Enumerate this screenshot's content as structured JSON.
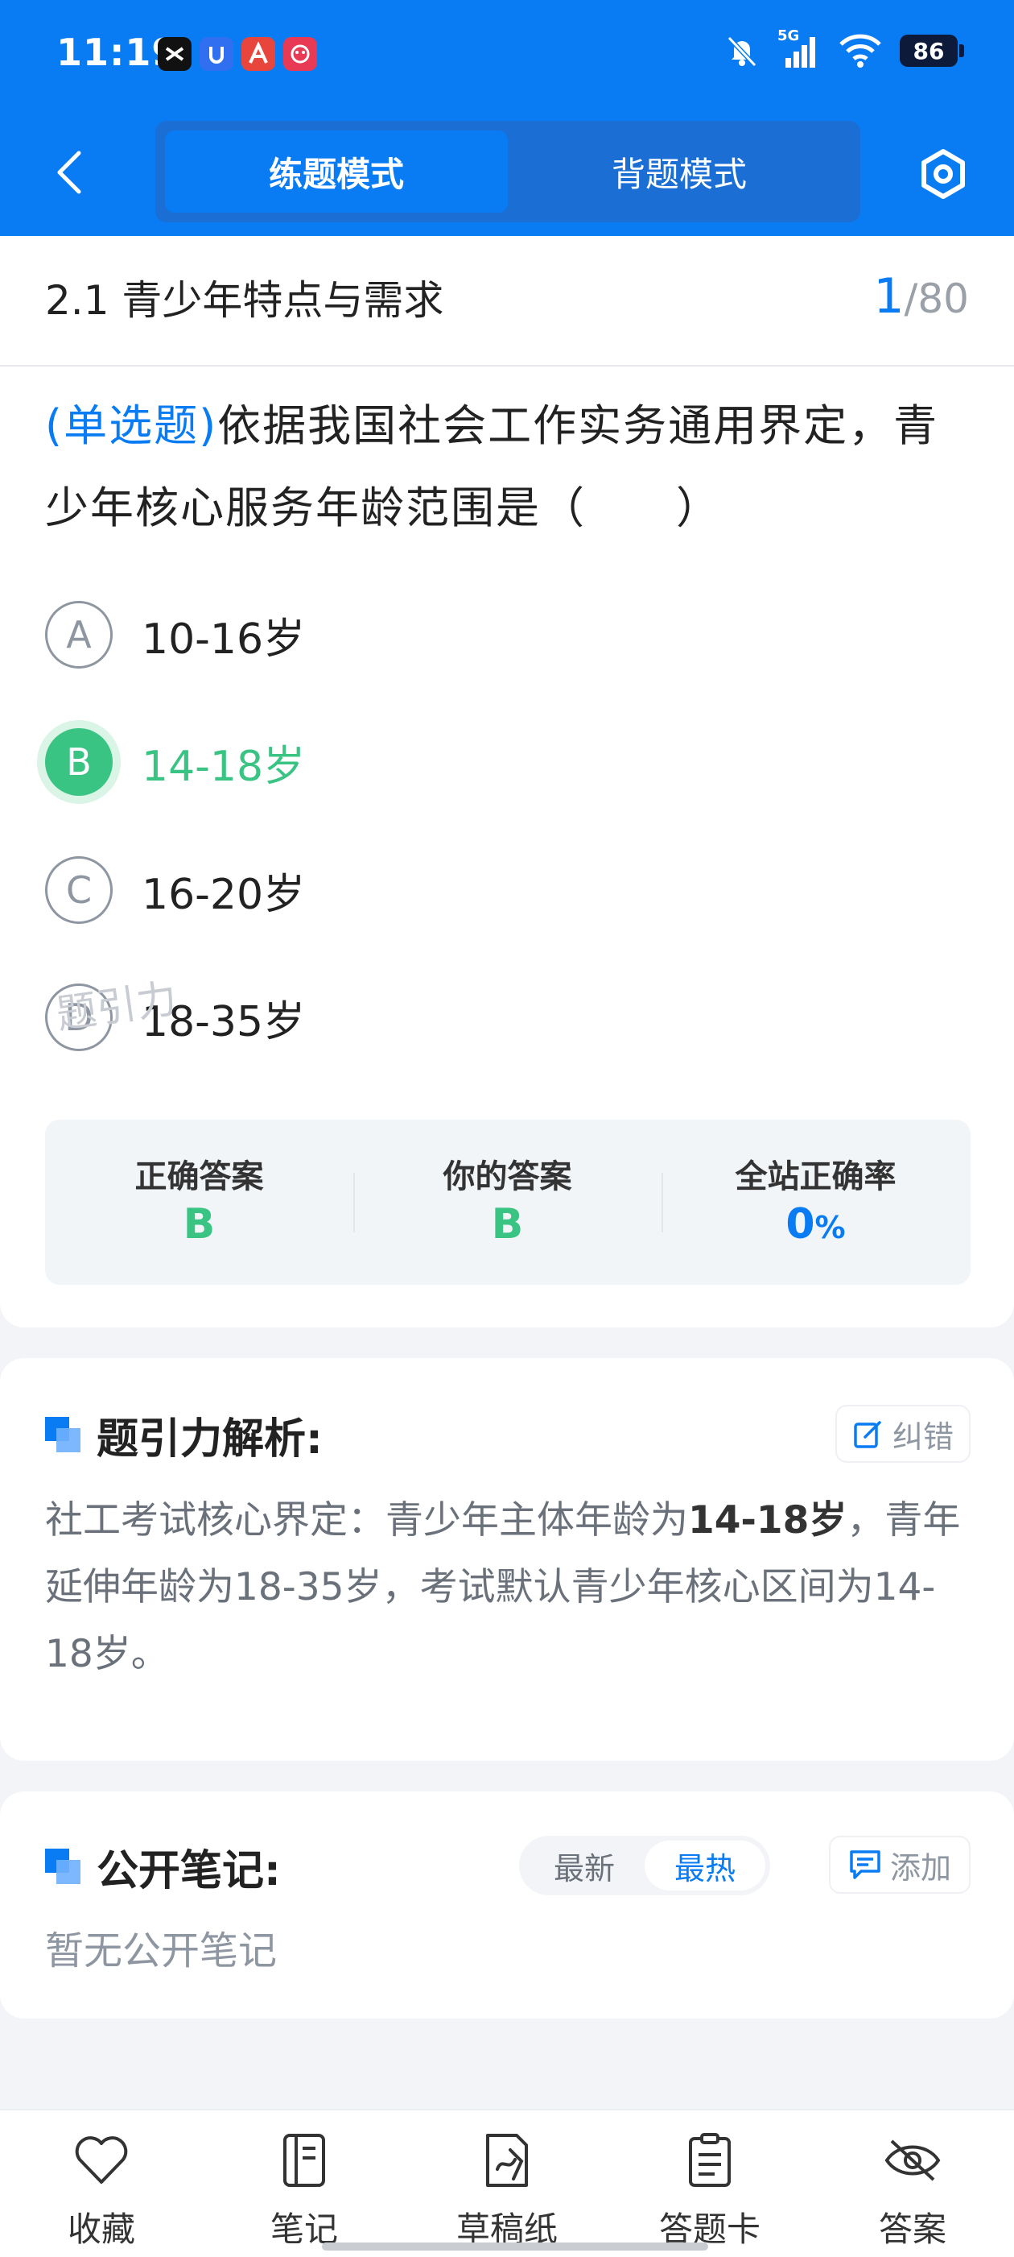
{
  "status_bar": {
    "time": "11:19",
    "battery": "86",
    "network": "5G"
  },
  "nav": {
    "tab_practice": "练题模式",
    "tab_memorize": "背题模式"
  },
  "section": {
    "title": "2.1 青少年特点与需求",
    "current": "1",
    "separator": "/",
    "total": "80"
  },
  "question": {
    "type": "(单选题)",
    "text": "依据我国社会工作实务通用界定，青少年核心服务年龄范围是（　　）"
  },
  "options": [
    {
      "letter": "A",
      "text": "10-16岁"
    },
    {
      "letter": "B",
      "text": "14-18岁",
      "selected": true
    },
    {
      "letter": "C",
      "text": "16-20岁"
    },
    {
      "letter": "D",
      "text": "18-35岁"
    }
  ],
  "answer": {
    "correct_label": "正确答案",
    "correct_value": "B",
    "yours_label": "你的答案",
    "yours_value": "B",
    "rate_label": "全站正确率",
    "rate_value": "0",
    "rate_unit": "%",
    "watermark": "题引力"
  },
  "analysis": {
    "title": "题引力解析:",
    "correction_label": "纠错",
    "text_part1": "社工考试核心界定：青少年主体年龄为",
    "text_bold": "14-18岁",
    "text_part2": "，青年延伸年龄为18-35岁，考试默认青少年核心区间为14-18岁。"
  },
  "notes": {
    "title": "公开笔记:",
    "sort_latest": "最新",
    "sort_hottest": "最热",
    "add_label": "添加",
    "empty": "暂无公开笔记"
  },
  "bottom_bar": [
    {
      "label": "收藏",
      "icon": "heart-icon"
    },
    {
      "label": "笔记",
      "icon": "notebook-icon"
    },
    {
      "label": "草稿纸",
      "icon": "draft-icon"
    },
    {
      "label": "答题卡",
      "icon": "answer-sheet-icon"
    },
    {
      "label": "答案",
      "icon": "eye-off-icon"
    }
  ],
  "colors": {
    "primary": "#0a7cf3",
    "correct": "#3ac483"
  }
}
